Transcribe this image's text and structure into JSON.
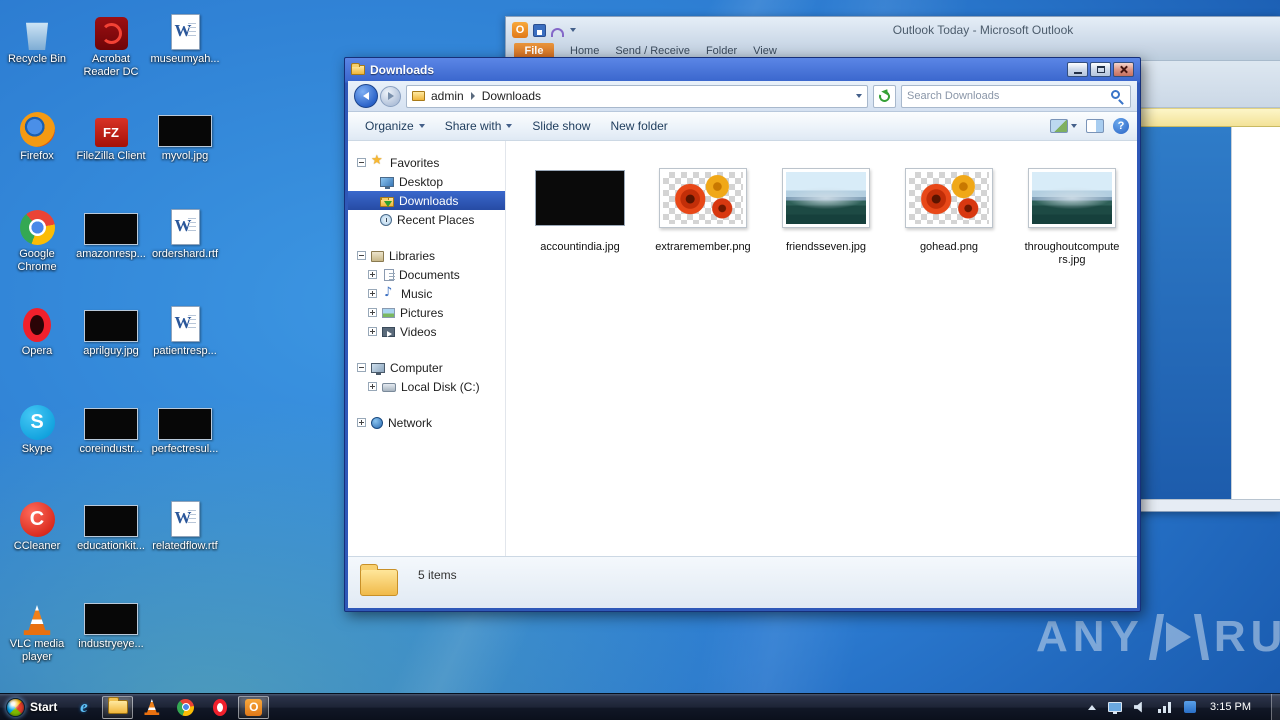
{
  "desktop": {
    "icons": [
      {
        "label": "Recycle Bin"
      },
      {
        "label": "Acrobat Reader DC"
      },
      {
        "label": "museumyah..."
      },
      {
        "label": "Firefox"
      },
      {
        "label": "FileZilla Client"
      },
      {
        "label": "myvol.jpg"
      },
      {
        "label": "Google Chrome"
      },
      {
        "label": "amazonresp..."
      },
      {
        "label": "ordershard.rtf"
      },
      {
        "label": "Opera"
      },
      {
        "label": "aprilguy.jpg"
      },
      {
        "label": "patientresp..."
      },
      {
        "label": "Skype"
      },
      {
        "label": "coreindustr..."
      },
      {
        "label": "perfectresul..."
      },
      {
        "label": "CCleaner"
      },
      {
        "label": "educationkit..."
      },
      {
        "label": "relatedflow.rtf"
      },
      {
        "label": "VLC media player"
      },
      {
        "label": "industryeye..."
      }
    ]
  },
  "outlook": {
    "title": "Outlook Today  -  Microsoft Outlook",
    "file_tab": "File",
    "tabs": [
      "Home",
      "Send / Receive",
      "Folder",
      "View"
    ]
  },
  "explorer": {
    "title": "Downloads",
    "address": {
      "root": "admin",
      "folder": "Downloads"
    },
    "search_placeholder": "Search Downloads",
    "toolbar": {
      "organize": "Organize",
      "share_with": "Share with",
      "slide_show": "Slide show",
      "new_folder": "New folder"
    },
    "sidebar": {
      "favorites_label": "Favorites",
      "desktop_label": "Desktop",
      "downloads_label": "Downloads",
      "recent_label": "Recent Places",
      "libraries_label": "Libraries",
      "documents_label": "Documents",
      "music_label": "Music",
      "pictures_label": "Pictures",
      "videos_label": "Videos",
      "computer_label": "Computer",
      "disk_label": "Local Disk (C:)",
      "network_label": "Network"
    },
    "files": [
      {
        "name": "accountindia.jpg"
      },
      {
        "name": "extraremember.png"
      },
      {
        "name": "friendsseven.jpg"
      },
      {
        "name": "gohead.png"
      },
      {
        "name": "throughoutcomputers.jpg"
      }
    ],
    "status": "5 items"
  },
  "taskbar": {
    "start_label": "Start",
    "clock": "3:15 PM"
  },
  "watermark": {
    "brand_left": "ANY",
    "brand_right": "RUN"
  }
}
